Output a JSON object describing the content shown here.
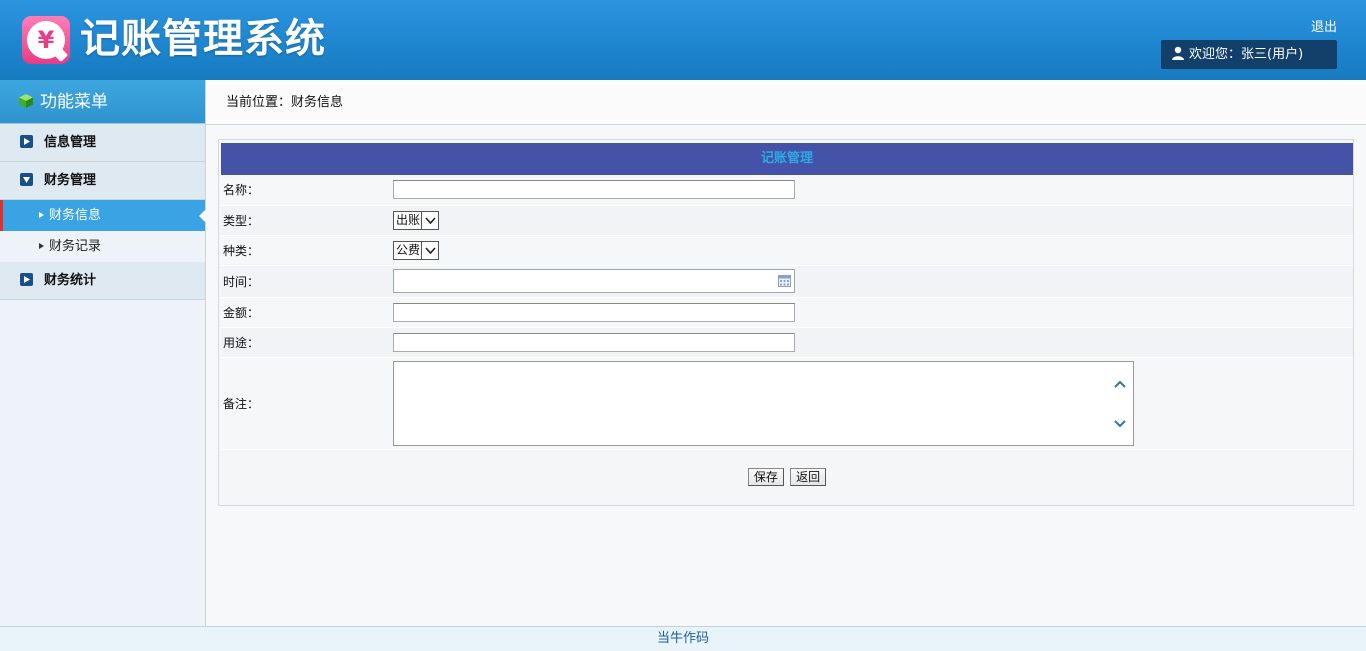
{
  "header": {
    "app_title": "记账管理系统",
    "logo_symbol": "¥",
    "logout_label": "退出",
    "welcome_text": "欢迎您：张三(用户)"
  },
  "sidebar": {
    "title": "功能菜单",
    "groups": [
      {
        "label": "信息管理",
        "expanded": false,
        "items": []
      },
      {
        "label": "财务管理",
        "expanded": true,
        "items": [
          {
            "label": "财务信息",
            "active": true
          },
          {
            "label": "财务记录",
            "active": false
          }
        ]
      },
      {
        "label": "财务统计",
        "expanded": false,
        "items": []
      }
    ]
  },
  "breadcrumb": "当前位置：财务信息",
  "form": {
    "title": "记账管理",
    "fields": {
      "name": {
        "label": "名称：",
        "value": ""
      },
      "type": {
        "label": "类型：",
        "value": "出账"
      },
      "category": {
        "label": "种类：",
        "value": "公费"
      },
      "time": {
        "label": "时间：",
        "value": ""
      },
      "amount": {
        "label": "金额：",
        "value": ""
      },
      "purpose": {
        "label": "用途：",
        "value": ""
      },
      "note": {
        "label": "备注：",
        "value": ""
      }
    },
    "save_label": "保存",
    "back_label": "返回"
  },
  "footer": "当牛作码",
  "colors": {
    "header_blue": "#2c95e0",
    "panel_title_bg": "#4453a7",
    "panel_title_text": "#2fa7e6",
    "active_menu": "#3aa3e3",
    "active_marker": "#e0302e"
  }
}
